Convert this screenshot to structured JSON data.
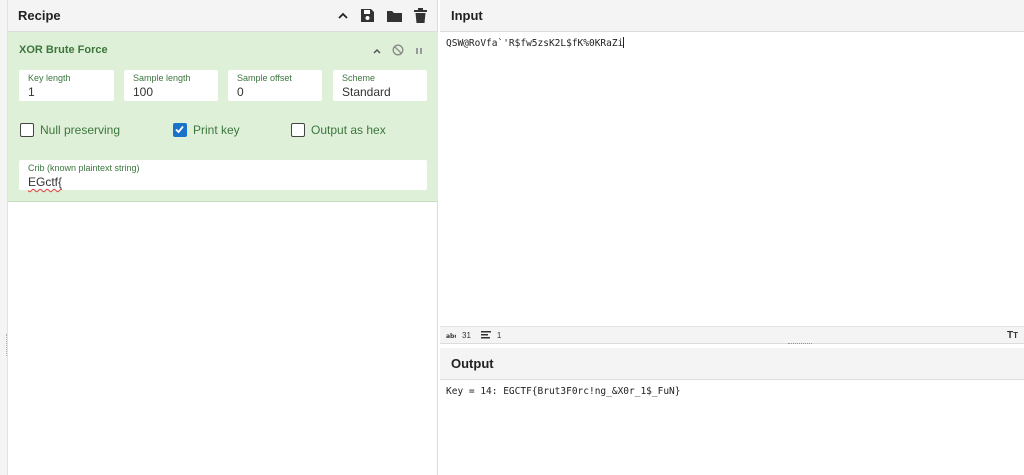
{
  "recipe": {
    "title": "Recipe",
    "header_icons": [
      "chevron-up-icon",
      "save-icon",
      "folder-icon",
      "trash-icon"
    ]
  },
  "operation": {
    "name": "XOR Brute Force",
    "fields": [
      {
        "label": "Key length",
        "value": "1"
      },
      {
        "label": "Sample length",
        "value": "100"
      },
      {
        "label": "Sample offset",
        "value": "0"
      },
      {
        "label": "Scheme",
        "value": "Standard"
      }
    ],
    "checkboxes": [
      {
        "label": "Null preserving",
        "checked": false
      },
      {
        "label": "Print key",
        "checked": true
      },
      {
        "label": "Output as hex",
        "checked": false
      }
    ],
    "crib": {
      "label": "Crib (known plaintext string)",
      "value": "EGctf{"
    }
  },
  "input": {
    "title": "Input",
    "text": "QSW@RoVfa`'R$fw5zsK2L$fK%0KRaZi",
    "char_count": "31",
    "line_count": "1"
  },
  "output": {
    "title": "Output",
    "text": "Key = 14: EGCTF{Brut3F0rc!ng_&X0r_1$_FuN}"
  },
  "colors": {
    "operation_bg": "#dff0d8",
    "operation_text": "#3c763d",
    "checkbox_checked": "#1a73c9"
  }
}
